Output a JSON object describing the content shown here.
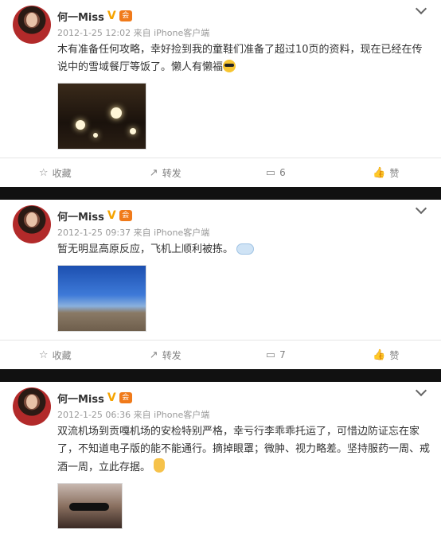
{
  "posts": [
    {
      "user": "何一Miss",
      "meta": "2012-1-25 12:02 来自 iPhone客户端",
      "text": "木有准备任何攻略，幸好捡到我的童鞋们准备了超过10页的资料，现在已经在传说中的雪域餐厅等饭了。懒人有懒福",
      "emoji": "cool-emoji",
      "image": "ceiling",
      "actions": {
        "fav": "收藏",
        "repost": "转发",
        "comment": "6",
        "like": "赞"
      }
    },
    {
      "user": "何一Miss",
      "meta": "2012-1-25 09:37 来自 iPhone客户端",
      "text": "暂无明显高原反应，飞机上顺利被拣。",
      "emoji": "cloud-emoji",
      "image": "sky",
      "actions": {
        "fav": "收藏",
        "repost": "转发",
        "comment": "7",
        "like": "赞"
      }
    },
    {
      "user": "何一Miss",
      "meta": "2012-1-25 06:36 来自 iPhone客户端",
      "text": "双流机场到贡嘎机场的安检特别严格，幸亏行李乖乖托运了，可惜边防证忘在家了，不知道电子版的能不能通行。摘掉眼罩；微肿、视力略差。坚持服药一周、戒酒一周，立此存据。",
      "emoji": "hand-emoji",
      "image": "portrait"
    }
  ],
  "badges": {
    "verified": "V",
    "member": "会"
  },
  "colors": {
    "accent": "#f5a300",
    "meta": "#999999",
    "bar": "#111111"
  }
}
